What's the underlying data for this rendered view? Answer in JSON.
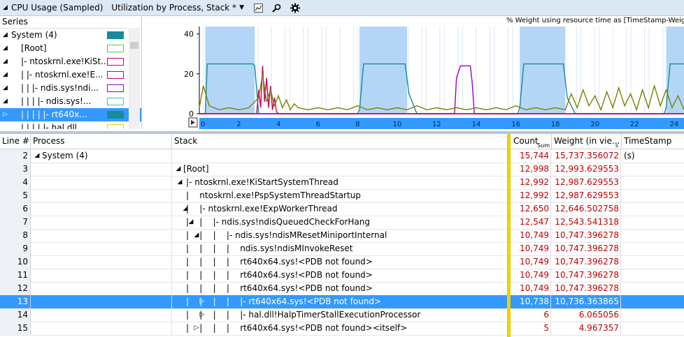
{
  "header": {
    "title": "CPU Usage (Sampled)",
    "preset": "Utilization by Process, Stack *",
    "collapse_glyph": "◢",
    "dropdown_glyph": "▼",
    "icons": [
      "graph-settings-icon",
      "search-icon",
      "gear-icon"
    ]
  },
  "series_pane": {
    "header": "Series",
    "rows": [
      {
        "label": "System (4)",
        "expander": "◢",
        "swatch": "#1a8a9a",
        "swatch_filled": true,
        "selected": false
      },
      {
        "label": "[Root]",
        "expander": "◢",
        "swatch": "#66cc33",
        "swatch_filled": false,
        "selected": false
      },
      {
        "label": "|- ntoskrnl.exe!KiSt...",
        "expander": "◢",
        "swatch": "#cc0066",
        "swatch_filled": false,
        "selected": false
      },
      {
        "label": "|   |- ntoskrnl.exe!E...",
        "expander": "◢",
        "swatch": "#cc0066",
        "swatch_filled": false,
        "selected": false
      },
      {
        "label": "|   |   |- ndis.sys!ndi...",
        "expander": "◢",
        "swatch": "#9900cc",
        "swatch_filled": false,
        "selected": false
      },
      {
        "label": "|   |   |   |- ndis.sys!...",
        "expander": "◢",
        "swatch": "#33cc99",
        "swatch_filled": false,
        "selected": false
      },
      {
        "label": "|   |   |   |   |- rt640x...",
        "expander": "▷",
        "swatch": "#1a8a9a",
        "swatch_filled": true,
        "selected": true
      },
      {
        "label": "|   |   |   |   |- hal.dll",
        "expander": "",
        "swatch": "#e0d000",
        "swatch_filled": false,
        "selected": false
      }
    ]
  },
  "chart_data": {
    "type": "line",
    "title": "% Weight using resource time as [TimeStamp-Weight,Time",
    "xlim": [
      0,
      24.5
    ],
    "ylim": [
      0,
      42
    ],
    "yticks": [
      0,
      20,
      40
    ],
    "xticks": [
      0,
      2,
      4,
      6,
      8,
      10,
      12,
      14,
      16,
      18,
      20,
      22,
      24
    ],
    "highlight_ranges": [
      [
        0.3,
        2.8
      ],
      [
        8.1,
        10.5
      ],
      [
        16.2,
        18.5
      ],
      [
        23.6,
        24.5
      ]
    ],
    "series": [
      {
        "color": "#1a8a9a",
        "x": [
          0,
          0.3,
          0.4,
          2.7,
          2.8,
          3.0,
          8.0,
          8.1,
          8.3,
          10.4,
          10.6,
          11.0,
          16.1,
          16.2,
          16.4,
          18.4,
          18.6,
          19.0,
          23.5,
          23.6,
          23.8,
          24.5
        ],
        "y": [
          0,
          0,
          25,
          25,
          24,
          0,
          0,
          2,
          25,
          25,
          10,
          0,
          0,
          3,
          25,
          25,
          8,
          0,
          0,
          3,
          25,
          25
        ]
      },
      {
        "color": "#9900cc",
        "x": [
          0,
          12.9,
          13.0,
          13.2,
          13.7,
          13.8,
          13.9,
          24.5
        ],
        "y": [
          0,
          0,
          18,
          24,
          24,
          15,
          0,
          0
        ]
      },
      {
        "color": "#cc0066",
        "x": [
          0,
          2.9,
          3.0,
          3.1,
          3.2,
          3.3,
          3.4,
          3.5,
          3.6,
          3.7,
          3.8,
          3.9,
          4.0,
          24.5
        ],
        "y": [
          0,
          0,
          12,
          3,
          24,
          6,
          18,
          3,
          14,
          2,
          8,
          1,
          0,
          0
        ]
      },
      {
        "color": "#808000",
        "x": [
          0,
          0.2,
          0.5,
          1.0,
          1.5,
          2.0,
          2.5,
          3.0,
          3.2,
          3.4,
          3.6,
          3.8,
          4.0,
          4.2,
          4.4,
          4.6,
          4.8,
          5.0,
          5.5,
          6.0,
          6.5,
          7.0,
          7.5,
          8.0,
          8.5,
          9.0,
          9.5,
          10.0,
          10.5,
          11.0,
          11.5,
          12.0,
          12.5,
          13.0,
          13.5,
          14.0,
          14.5,
          15.0,
          15.5,
          16.0,
          16.5,
          17.0,
          17.5,
          18.0,
          18.5,
          18.8,
          19.1,
          19.4,
          19.7,
          20.0,
          20.3,
          20.6,
          20.9,
          21.2,
          21.5,
          21.8,
          22.1,
          22.4,
          22.7,
          23.0,
          23.3,
          23.6,
          23.9,
          24.2,
          24.5
        ],
        "y": [
          3,
          14,
          4,
          2,
          3,
          2,
          3,
          8,
          20,
          6,
          12,
          4,
          9,
          3,
          7,
          2,
          5,
          3,
          2,
          3,
          2,
          3,
          2,
          4,
          2,
          3,
          2,
          3,
          2,
          4,
          2,
          3,
          2,
          3,
          2,
          3,
          2,
          3,
          2,
          4,
          2,
          3,
          2,
          3,
          2,
          10,
          3,
          12,
          4,
          9,
          2,
          11,
          3,
          13,
          4,
          10,
          2,
          12,
          3,
          14,
          4,
          12,
          3,
          9,
          2
        ]
      }
    ]
  },
  "table": {
    "columns": [
      {
        "id": "line",
        "label": "Line #"
      },
      {
        "id": "process",
        "label": "Process"
      },
      {
        "id": "stack",
        "label": "Stack"
      },
      {
        "id": "count",
        "label": "Count",
        "sub": "Sum"
      },
      {
        "id": "weight",
        "label": "Weight (in vie...",
        "sub": "s"
      },
      {
        "id": "ts",
        "label": "TimeStamp (s)"
      }
    ],
    "rows": [
      {
        "line": "2",
        "process": "System (4)",
        "proc_exp": "◢",
        "stack": "",
        "stack_indent": 0,
        "stack_exp": "",
        "count": "15,744",
        "weight": "15,737.356072",
        "selected": false
      },
      {
        "line": "3",
        "process": "",
        "proc_exp": "",
        "stack": "[Root]",
        "stack_indent": 0,
        "stack_exp": "◢",
        "count": "12,998",
        "weight": "12,993.629553",
        "selected": false
      },
      {
        "line": "4",
        "process": "",
        "proc_exp": "",
        "stack": "|- ntoskrnl.exe!KiStartSystemThread",
        "stack_indent": 1,
        "stack_exp": "◢",
        "count": "12,992",
        "weight": "12,987.629553",
        "selected": false
      },
      {
        "line": "5",
        "process": "",
        "proc_exp": "",
        "stack": "|    ntoskrnl.exe!PspSystemThreadStartup",
        "stack_indent": 1,
        "stack_exp": "",
        "count": "12,992",
        "weight": "12,987.629553",
        "selected": false
      },
      {
        "line": "6",
        "process": "",
        "proc_exp": "",
        "stack": "|    |- ntoskrnl.exe!ExpWorkerThread",
        "stack_indent": 1,
        "stack_exp": "◢",
        "count": "12,650",
        "weight": "12,646.502758",
        "selected": false
      },
      {
        "line": "7",
        "process": "",
        "proc_exp": "",
        "stack": "|    |    |- ndis.sys!ndisQueuedCheckForHang",
        "stack_indent": 1,
        "stack_exp": "◢",
        "count": "12,547",
        "weight": "12,543.541318",
        "selected": false
      },
      {
        "line": "8",
        "process": "",
        "proc_exp": "",
        "stack": "|    |    |    |- ndis.sys!ndisMResetMiniportInternal",
        "stack_indent": 1,
        "stack_exp": "◢",
        "count": "10,749",
        "weight": "10,747.396278",
        "selected": false
      },
      {
        "line": "9",
        "process": "",
        "proc_exp": "",
        "stack": "|    |    |    |    ndis.sys!ndisMInvokeReset",
        "stack_indent": 1,
        "stack_exp": "",
        "count": "10,749",
        "weight": "10,747.396278",
        "selected": false
      },
      {
        "line": "10",
        "process": "",
        "proc_exp": "",
        "stack": "|    |    |    |    rt640x64.sys!<PDB not found>",
        "stack_indent": 1,
        "stack_exp": "",
        "count": "10,749",
        "weight": "10,747.396278",
        "selected": false
      },
      {
        "line": "11",
        "process": "",
        "proc_exp": "",
        "stack": "|    |    |    |    rt640x64.sys!<PDB not found>",
        "stack_indent": 1,
        "stack_exp": "",
        "count": "10,749",
        "weight": "10,747.396278",
        "selected": false
      },
      {
        "line": "12",
        "process": "",
        "proc_exp": "",
        "stack": "|    |    |    |    rt640x64.sys!<PDB not found>",
        "stack_indent": 1,
        "stack_exp": "",
        "count": "10,749",
        "weight": "10,747.396278",
        "selected": false
      },
      {
        "line": "13",
        "process": "",
        "proc_exp": "",
        "stack": "|    |    |    |    |- rt640x64.sys!<PDB not found>",
        "stack_indent": 1,
        "stack_exp": "▷",
        "count": "10,738",
        "weight": "10,736.363865",
        "selected": true
      },
      {
        "line": "14",
        "process": "",
        "proc_exp": "",
        "stack": "|    |    |    |    |- hal.dll!HalpTimerStallExecutionProcessor",
        "stack_indent": 1,
        "stack_exp": "▷",
        "count": "6",
        "weight": "6.065056",
        "selected": false
      },
      {
        "line": "15",
        "process": "",
        "proc_exp": "",
        "stack": "|    |    |    |    rt640x64.sys!<PDB not found><itself>",
        "stack_indent": 1,
        "stack_exp": "▷",
        "count": "5",
        "weight": "4.967357",
        "selected": false
      }
    ]
  }
}
